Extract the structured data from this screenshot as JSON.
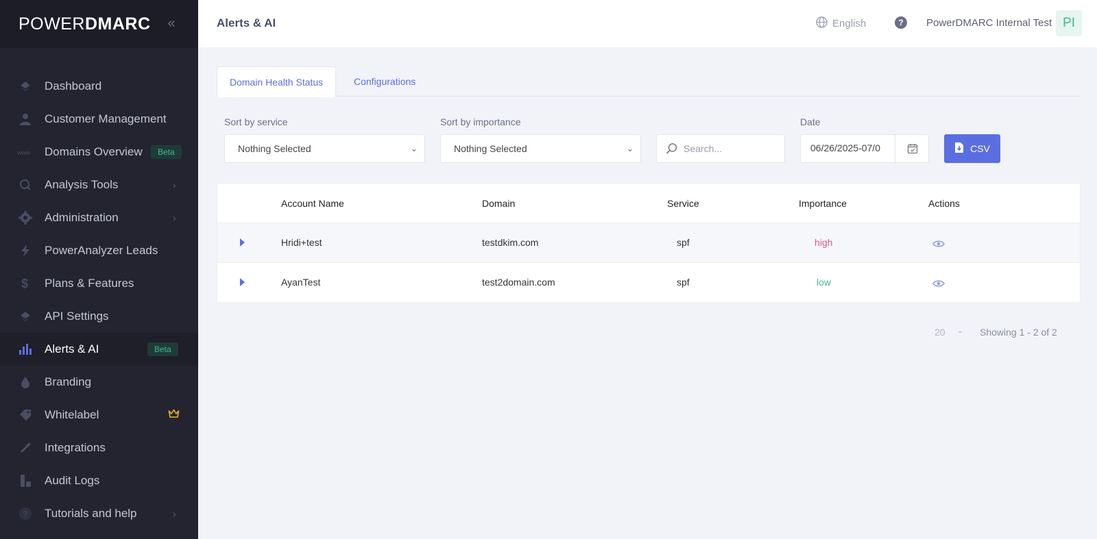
{
  "brand": {
    "logo_light": "POWER",
    "logo_bold": "DMARC"
  },
  "sidebar": {
    "items": [
      {
        "label": "Dashboard",
        "icon": "diamond-icon"
      },
      {
        "label": "Customer Management",
        "icon": "person-icon"
      },
      {
        "label": "Domains Overview",
        "icon": "www-icon",
        "badge": "Beta"
      },
      {
        "label": "Analysis Tools",
        "icon": "search-icon",
        "chevron": "›"
      },
      {
        "label": "Administration",
        "icon": "gear-icon",
        "chevron": "›"
      },
      {
        "label": "PowerAnalyzer Leads",
        "icon": "bolt-icon"
      },
      {
        "label": "Plans & Features",
        "icon": "dollar-icon"
      },
      {
        "label": "API Settings",
        "icon": "diamond-icon"
      },
      {
        "label": "Alerts & AI",
        "icon": "bar-chart-icon",
        "badge": "Beta",
        "active": true
      },
      {
        "label": "Branding",
        "icon": "drop-icon"
      },
      {
        "label": "Whitelabel",
        "icon": "tag-icon",
        "extra_icon": "crown-icon"
      },
      {
        "label": "Integrations",
        "icon": "wand-icon"
      },
      {
        "label": "Audit Logs",
        "icon": "logs-icon"
      },
      {
        "label": "Tutorials and help",
        "icon": "question-icon",
        "chevron": "›"
      }
    ]
  },
  "header": {
    "title": "Alerts & AI",
    "language": "English",
    "help": "?",
    "org_name": "PowerDMARC Internal Test",
    "avatar_initials": "PI"
  },
  "tabs": [
    {
      "label": "Domain Health Status",
      "active": true
    },
    {
      "label": "Configurations",
      "active": false
    }
  ],
  "filters": {
    "service_label": "Sort by service",
    "service_value": "Nothing Selected",
    "importance_label": "Sort by importance",
    "importance_value": "Nothing Selected",
    "search_placeholder": "Search...",
    "date_label": "Date",
    "date_value": "06/26/2025-07/0",
    "csv_label": "CSV"
  },
  "table": {
    "columns": [
      "Account Name",
      "Domain",
      "Service",
      "Importance",
      "Actions"
    ],
    "rows": [
      {
        "account": "Hridi+test",
        "domain": "testdkim.com",
        "service": "spf",
        "importance": "high"
      },
      {
        "account": "AyanTest",
        "domain": "test2domain.com",
        "service": "spf",
        "importance": "low"
      }
    ]
  },
  "pagination": {
    "page_size": "20",
    "showing": "Showing 1 - 2 of 2"
  },
  "colors": {
    "accent": "#5b6ee0",
    "sidebar_bg": "#23242f",
    "importance_high": "#e0578f",
    "importance_low": "#3dbb93",
    "beta_badge": "#3dbb93",
    "crown": "#f0b429"
  }
}
